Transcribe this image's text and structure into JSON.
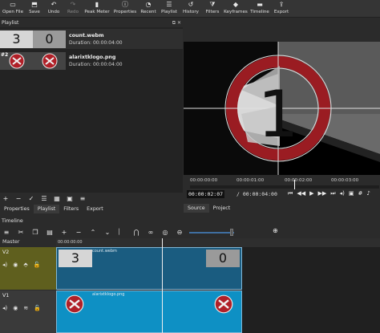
{
  "toolbar": {
    "items": [
      {
        "label": "Open File",
        "icon": "folder-icon"
      },
      {
        "label": "Save",
        "icon": "save-icon"
      },
      {
        "label": "Undo",
        "icon": "undo-icon"
      },
      {
        "label": "Redo",
        "icon": "redo-icon",
        "disabled": true
      },
      {
        "label": "Peak Meter",
        "icon": "peak-meter-icon"
      },
      {
        "label": "Properties",
        "icon": "info-icon"
      },
      {
        "label": "Recent",
        "icon": "clock-icon"
      },
      {
        "label": "Playlist",
        "icon": "list-icon"
      },
      {
        "label": "History",
        "icon": "history-icon"
      },
      {
        "label": "Filters",
        "icon": "filter-icon"
      },
      {
        "label": "Keyframes",
        "icon": "keyframes-icon"
      },
      {
        "label": "Timeline",
        "icon": "timeline-icon"
      },
      {
        "label": "Export",
        "icon": "export-icon"
      }
    ]
  },
  "playlist": {
    "title": "Playlist",
    "items": [
      {
        "name": "count.webm",
        "duration": "Duration: 00:00:04:00",
        "thumb_left": "3",
        "thumb_right": "0"
      },
      {
        "index": "#2",
        "name": "alarixtklogo.png",
        "duration": "Duration: 00:00:04:00"
      }
    ]
  },
  "left_tabs": [
    "Properties",
    "Playlist",
    "Filters",
    "Export"
  ],
  "player": {
    "ruler_labels": [
      "00:00:00:00",
      "00:00:01:00",
      "00:00:02:00",
      "00:00:03:00"
    ],
    "timecode_current": "00:00:02:07",
    "timecode_total": "/ 00:00:04:00",
    "tabs": [
      "Source",
      "Project"
    ],
    "countdown_digit": "1"
  },
  "timeline": {
    "title": "Timeline",
    "ruler_label": "00:00:00:00",
    "master_label": "Master",
    "tracks": [
      {
        "name": "V2",
        "clip_label": "count.webm",
        "thumb_left": "3",
        "thumb_right": "0"
      },
      {
        "name": "V1",
        "clip_label": "alarixtklogo.png"
      }
    ]
  },
  "colors": {
    "accent": "#3f6ea0",
    "v2_track": "#5f5f1e",
    "clip_v2": "#1a5c80",
    "clip_v1": "#0e90c4",
    "logo_red": "#b02028"
  }
}
